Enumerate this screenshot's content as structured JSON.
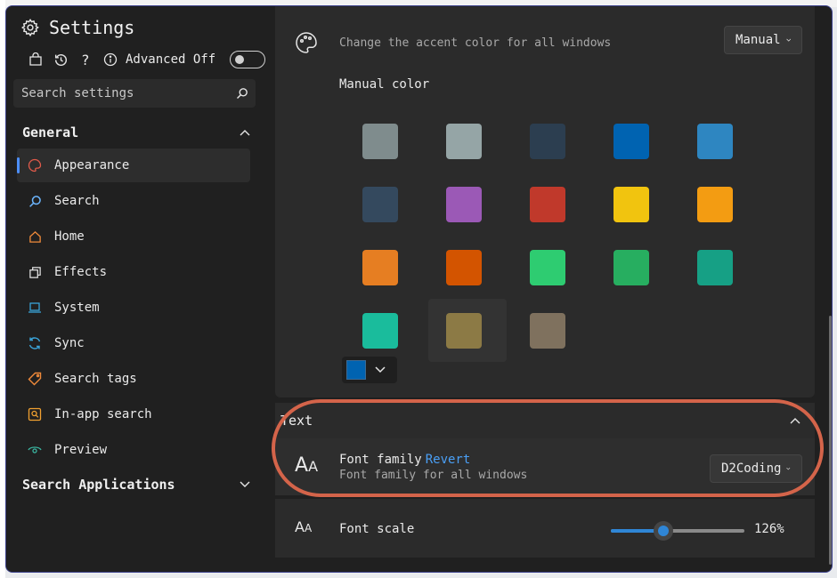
{
  "app": {
    "title": "Settings"
  },
  "toolbar": {
    "advanced_label": "Advanced Off"
  },
  "search": {
    "placeholder": "Search settings"
  },
  "sidebar": {
    "group_general": "General",
    "items": [
      {
        "label": "Appearance",
        "icon": "palette-icon",
        "color": "#e05a4a"
      },
      {
        "label": "Search",
        "icon": "search-icon",
        "color": "#6cb6ff"
      },
      {
        "label": "Home",
        "icon": "home-icon",
        "color": "#f08a3a"
      },
      {
        "label": "Effects",
        "icon": "effects-icon",
        "color": "#e6e6e6"
      },
      {
        "label": "System",
        "icon": "laptop-icon",
        "color": "#3aa3d8"
      },
      {
        "label": "Sync",
        "icon": "sync-icon",
        "color": "#3aa3d8"
      },
      {
        "label": "Search tags",
        "icon": "tag-icon",
        "color": "#f08a3a"
      },
      {
        "label": "In-app search",
        "icon": "in-app-search-icon",
        "color": "#f0a030"
      },
      {
        "label": "Preview",
        "icon": "eye-icon",
        "color": "#3ab5a0"
      }
    ],
    "group_apps": "Search Applications"
  },
  "accent": {
    "description": "Change the accent color for all windows",
    "mode_value": "Manual",
    "manual_label": "Manual color",
    "swatches": [
      [
        "#7f8c8d",
        "#95a5a6",
        "#2c3e50",
        "#0063b1",
        "#2e86c1"
      ],
      [
        "#34495e",
        "#9b59b6",
        "#c0392b",
        "#f1c40f",
        "#f39c12"
      ],
      [
        "#e67e22",
        "#d35400",
        "#2ecc71",
        "#27ae60",
        "#16a085"
      ],
      [
        "#1abc9c",
        "#8c7a45",
        "#7f715e"
      ]
    ],
    "selected_color": "#0063b1"
  },
  "text_section": {
    "title": "Text",
    "font_family": {
      "title": "Font family",
      "revert": "Revert",
      "description": "Font family for all windows",
      "value": "D2Coding"
    },
    "font_scale": {
      "title": "Font scale",
      "value_label": "126%",
      "fraction": 0.39
    }
  }
}
